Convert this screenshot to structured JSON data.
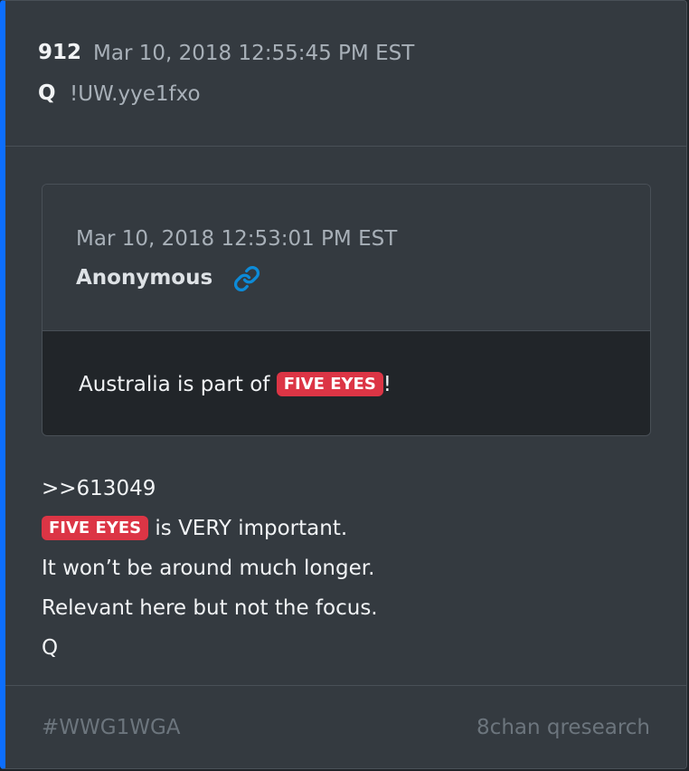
{
  "post": {
    "number": "912",
    "timestamp": "Mar 10, 2018 12:55:45 PM EST",
    "author": "Q",
    "tripcode": "!UW.yye1fxo"
  },
  "quoted_post": {
    "timestamp": "Mar 10, 2018 12:53:01 PM EST",
    "author": "Anonymous",
    "link_icon": "link-icon",
    "text_before": "Australia is part of ",
    "tag": "FIVE EYES",
    "text_after": "!"
  },
  "body": {
    "reply_ref": ">>613049",
    "line1_tag": "FIVE EYES",
    "line1_text": " is VERY important.",
    "line2": "It won’t be around much longer.",
    "line3": "Relevant here but not the focus.",
    "signature": "Q"
  },
  "footer": {
    "hashtag": "#WWG1WGA",
    "source": "8chan qresearch"
  },
  "colors": {
    "accent_border": "#0d6efd",
    "tag_background": "#dc3545",
    "link_icon": "#0d8bd8"
  }
}
